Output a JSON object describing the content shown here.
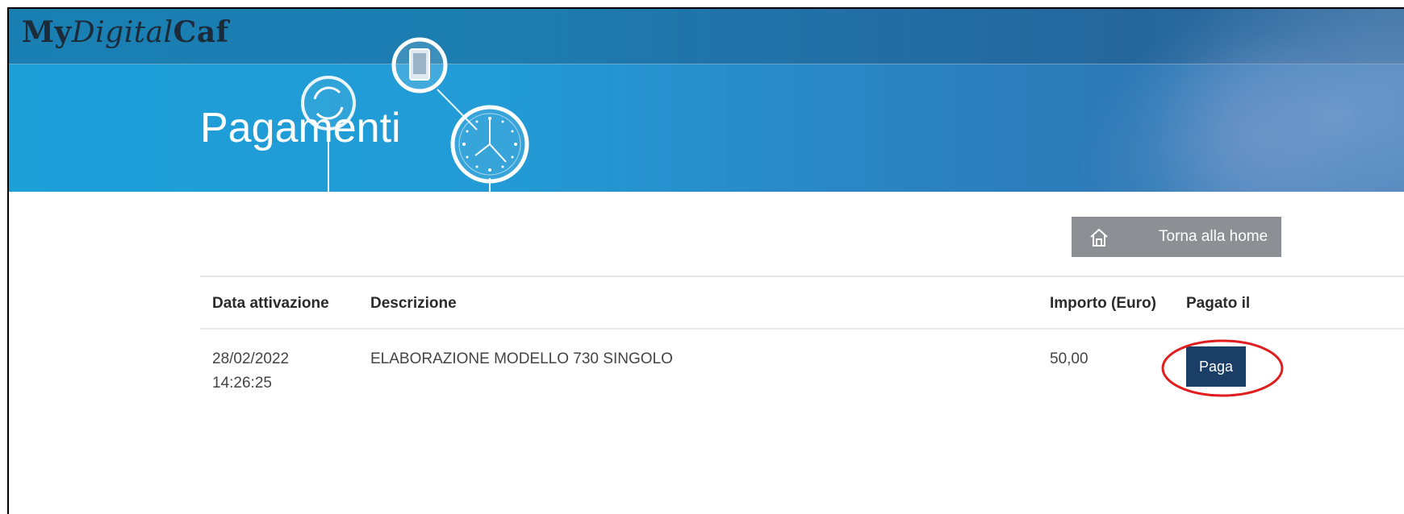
{
  "brand": {
    "part1": "My",
    "part2": "Digital",
    "part3": "Caf"
  },
  "page": {
    "title": "Pagamenti"
  },
  "toolbar": {
    "home_label": "Torna alla home"
  },
  "table": {
    "headers": [
      "Data attivazione",
      "Descrizione",
      "Importo (Euro)",
      "Pagato il"
    ],
    "rows": [
      {
        "date": "28/02/2022",
        "time": "14:26:25",
        "description": "ELABORAZIONE MODELLO 730 SINGOLO",
        "amount": "50,00",
        "action": "Paga"
      }
    ]
  },
  "colors": {
    "hero": "#229bd6",
    "home_button": "#8c8f93",
    "pay_button": "#1b3e66",
    "highlight": "#e01e1e"
  },
  "icons": [
    "home-icon",
    "refresh-icon",
    "phone-icon",
    "clock-icon"
  ]
}
